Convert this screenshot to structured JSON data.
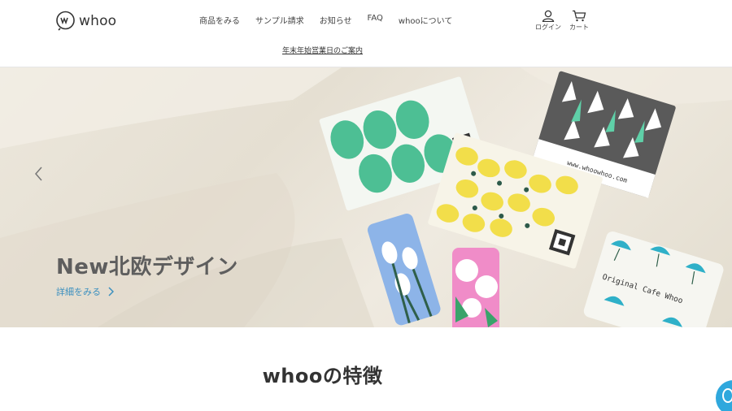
{
  "header": {
    "logo_text": "whoo",
    "nav": [
      "商品をみる",
      "サンプル請求",
      "お知らせ",
      "FAQ",
      "whooについて"
    ],
    "notice_link": "年末年始営業日のご案内",
    "login_label": "ログイン",
    "cart_label": "カート"
  },
  "hero": {
    "title": "New北欧デザイン",
    "link": "詳細をみる",
    "card_url_text": "www.whoowhoo.com",
    "card_cafe_text": "Original Cafe Whoo"
  },
  "section": {
    "title": "whooの特徴"
  },
  "colors": {
    "accent": "#3a8fbf",
    "chat": "#2fa8dd",
    "card_green": "#4dbf94",
    "card_yellow": "#f2de4a",
    "card_gray": "#5a5a5a",
    "card_blue": "#8db4e8",
    "card_pink": "#f08cc8"
  },
  "icons": [
    "whoo-logo-icon",
    "user-icon",
    "cart-icon",
    "chevron-left-icon",
    "chevron-right-icon",
    "chat-icon"
  ]
}
